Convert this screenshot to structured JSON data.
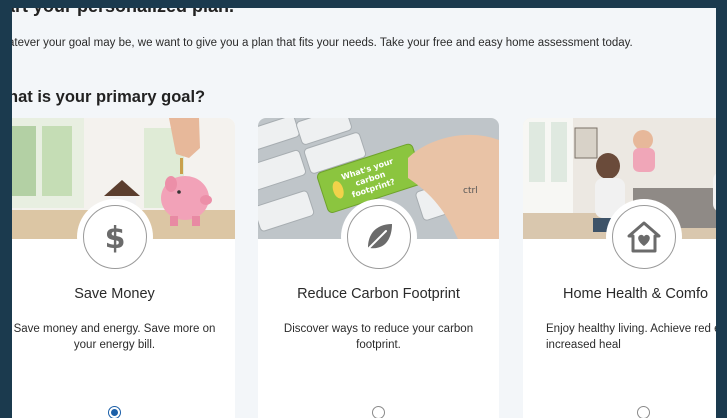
{
  "header": {
    "title": "art your personalized plan.",
    "intro": "atever your goal may be, we want to give you a plan that fits your needs. Take your free and easy home assessment today."
  },
  "question": "hat is your primary goal?",
  "cards": [
    {
      "title": "Save Money",
      "desc": "Save money and energy. Save more on your energy bill.",
      "icon": "dollar-icon",
      "selected": true
    },
    {
      "title": "Reduce Carbon Footprint",
      "desc": "Discover ways to reduce your carbon footprint.",
      "icon": "leaf-icon",
      "photo_key_text": "What's your carbon footprint?",
      "photo_key_label": "ctrl",
      "selected": false
    },
    {
      "title": "Home Health & Comfo",
      "desc": "Enjoy healthy living. Achieve red energy use and increased heal",
      "icon": "house-heart-icon",
      "selected": false
    }
  ],
  "colors": {
    "frame": "#1b3a4e",
    "background": "#f3f6f9",
    "radio_selected": "#1b5fa8",
    "key_green": "#8bc53f"
  }
}
